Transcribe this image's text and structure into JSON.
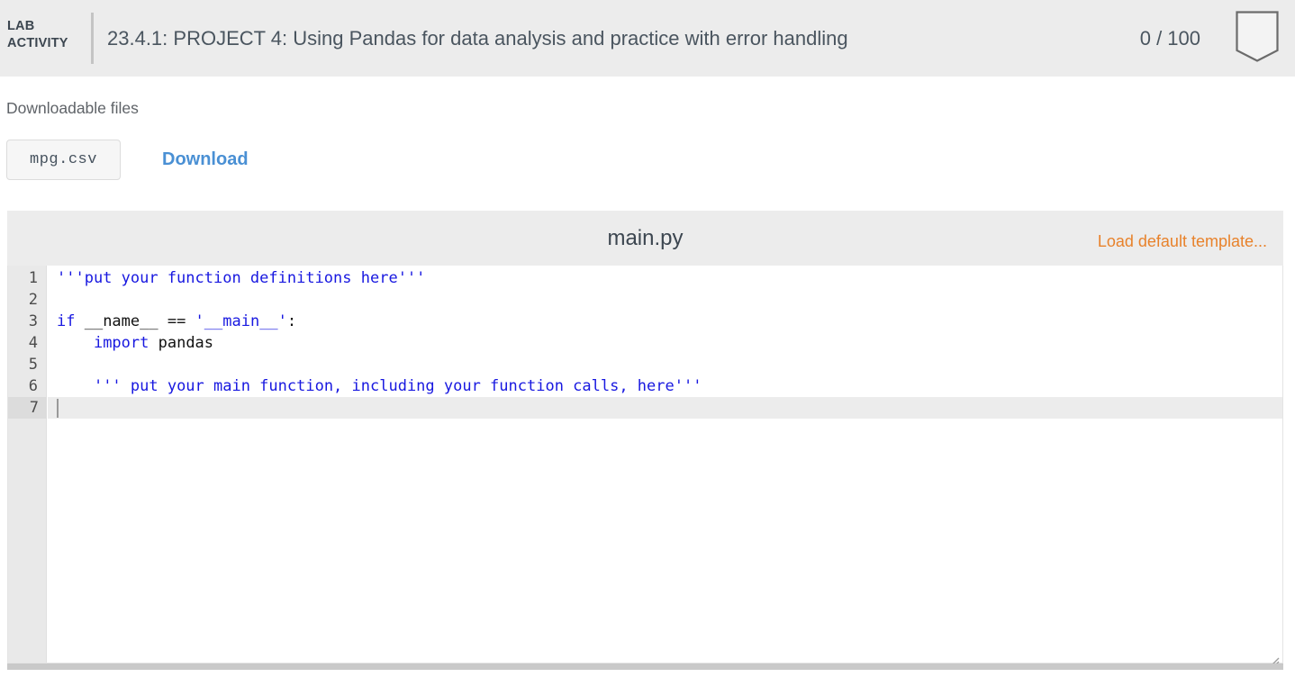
{
  "lab_header": {
    "badge_line1": "LAB",
    "badge_line2": "ACTIVITY",
    "title": "23.4.1: PROJECT 4: Using Pandas for data analysis and practice with error handling",
    "score": "0 / 100",
    "shield_icon": "shield-badge-icon",
    "bg_color": "#ececec",
    "text_color": "#4a555f"
  },
  "downloads": {
    "heading": "Downloadable files",
    "file_name": "mpg.csv",
    "download_label": "Download",
    "link_color": "#4a90d4"
  },
  "editor": {
    "filename": "main.py",
    "load_template_label": "Load default template...",
    "load_template_color": "#e8822b",
    "active_line": 7,
    "cursor_line": 7,
    "gutter_numbers": [
      "1",
      "2",
      "3",
      "4",
      "5",
      "6",
      "7"
    ],
    "code_lines": [
      {
        "number": "1",
        "tokens": [
          {
            "text": "'''put your function definitions here'''",
            "type": "str"
          }
        ]
      },
      {
        "number": "2",
        "tokens": [
          {
            "text": "",
            "type": "txt"
          }
        ]
      },
      {
        "number": "3",
        "tokens": [
          {
            "text": "if",
            "type": "kw"
          },
          {
            "text": " __name__ == ",
            "type": "txt"
          },
          {
            "text": "'__main__'",
            "type": "str"
          },
          {
            "text": ":",
            "type": "txt"
          }
        ]
      },
      {
        "number": "4",
        "tokens": [
          {
            "text": "    ",
            "type": "txt"
          },
          {
            "text": "import",
            "type": "kw"
          },
          {
            "text": " pandas",
            "type": "txt"
          }
        ]
      },
      {
        "number": "5",
        "tokens": [
          {
            "text": "",
            "type": "txt"
          }
        ]
      },
      {
        "number": "6",
        "tokens": [
          {
            "text": "    ",
            "type": "txt"
          },
          {
            "text": "''' put your main function, including your function calls, here'''",
            "type": "str"
          }
        ]
      },
      {
        "number": "7",
        "tokens": [
          {
            "text": "",
            "type": "txt"
          }
        ]
      }
    ],
    "resize_handle_icon": "resize-grip-icon"
  }
}
